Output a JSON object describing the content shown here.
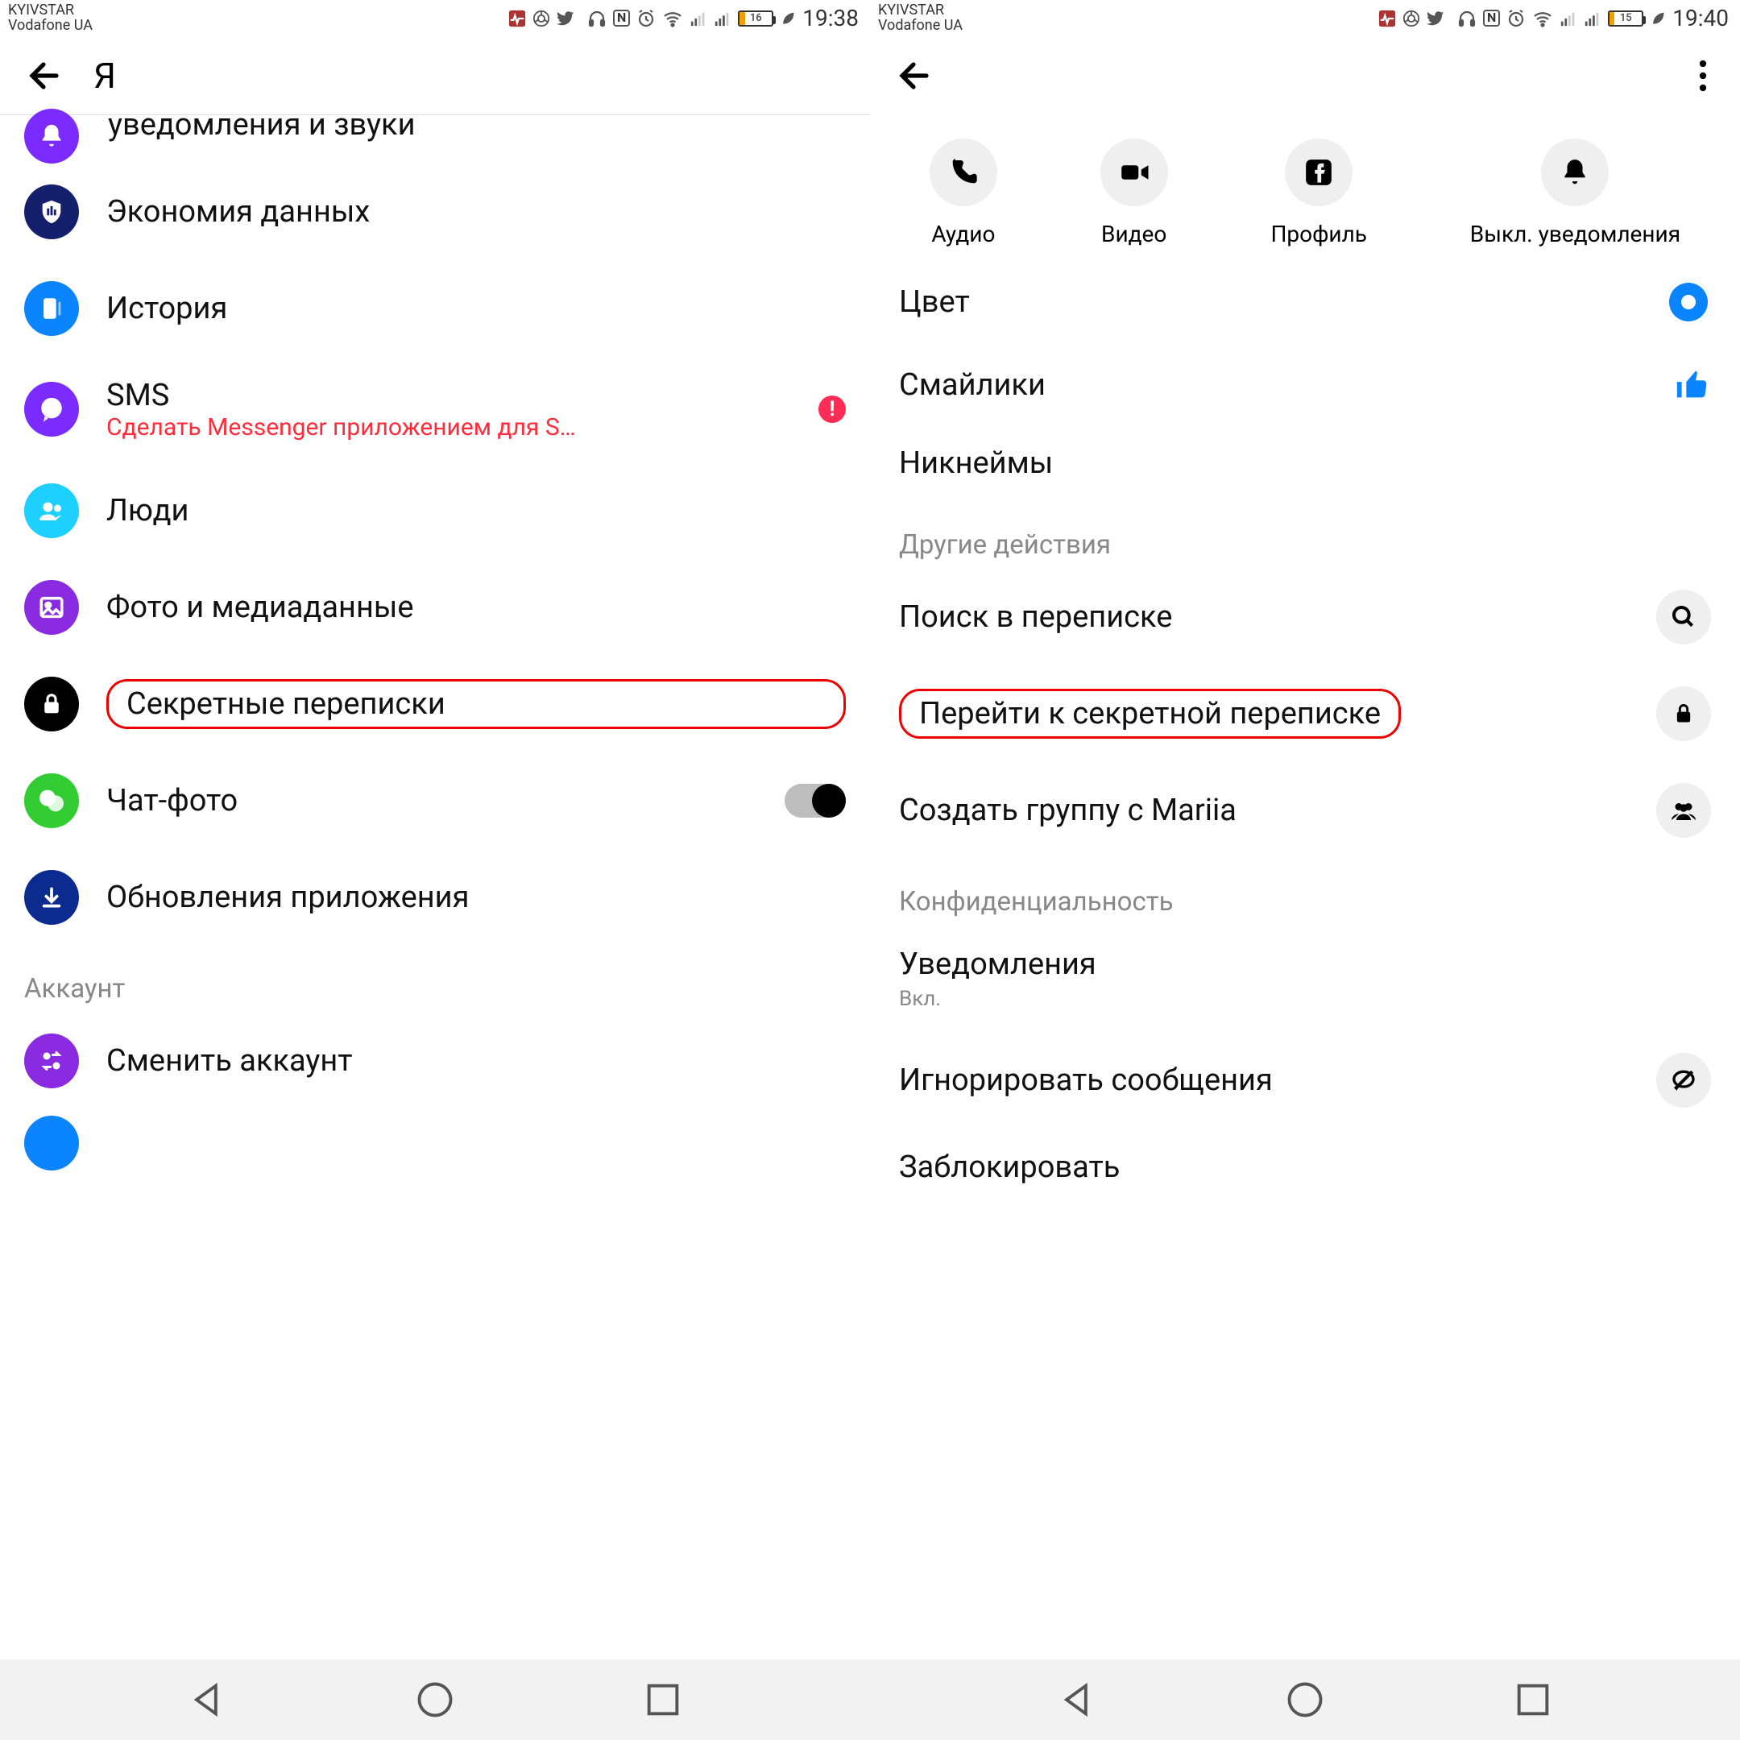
{
  "status_left": {
    "carrier1": "KYIVSTAR",
    "carrier2": "Vodafone UA",
    "battery_pct": "16",
    "time": "19:38"
  },
  "status_right": {
    "carrier1": "KYIVSTAR",
    "carrier2": "Vodafone UA",
    "battery_pct": "15",
    "time": "19:40"
  },
  "left": {
    "title": "Я",
    "notifications_cut": "уведомления и звуки",
    "items": {
      "data_saver": "Экономия данных",
      "history": "История",
      "sms": "SMS",
      "sms_sub": "Сделать Messenger приложением для S…",
      "people": "Люди",
      "photos": "Фото и медиаданные",
      "secret": "Секретные переписки",
      "chat_heads": "Чат-фото",
      "updates": "Обновления приложения"
    },
    "section_account": "Аккаунт",
    "switch_account": "Сменить аккаунт"
  },
  "right": {
    "shortcuts": {
      "audio": "Аудио",
      "video": "Видео",
      "profile": "Профиль",
      "mute": "Выкл. уведомления"
    },
    "color": "Цвет",
    "emoji": "Смайлики",
    "nicknames": "Никнеймы",
    "section_other": "Другие действия",
    "search": "Поиск в переписке",
    "go_secret": "Перейти к секретной переписке",
    "create_group": "Создать группу с Mariia",
    "section_privacy": "Конфиденциальность",
    "notifications": "Уведомления",
    "notifications_sub": "Вкл.",
    "ignore": "Игнорировать сообщения",
    "block": "Заблокировать"
  }
}
